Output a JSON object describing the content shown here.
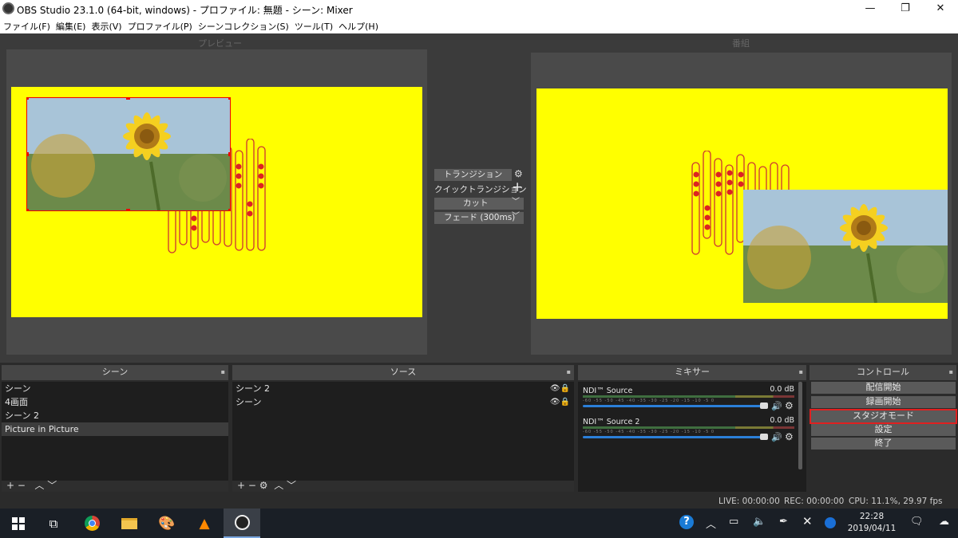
{
  "window": {
    "title": "OBS Studio 23.1.0 (64-bit, windows) - プロファイル: 無題 - シーン: Mixer",
    "minimize": "—",
    "maximize": "❐",
    "close": "✕"
  },
  "menu": [
    "ファイル(F)",
    "編集(E)",
    "表示(V)",
    "プロファイル(P)",
    "シーンコレクション(S)",
    "ツール(T)",
    "ヘルプ(H)"
  ],
  "preview": {
    "label": "プレビュー"
  },
  "program": {
    "label": "番組"
  },
  "transition": {
    "button": "トランジション",
    "quick": "クイックトランジション",
    "cut": "カット",
    "fade": "フェード (300ms)"
  },
  "scenes": {
    "title": "シーン",
    "items": [
      "シーン",
      "4画面",
      "シーン 2",
      "Picture in Picture"
    ],
    "selected": 3
  },
  "sources": {
    "title": "ソース",
    "items": [
      "シーン 2",
      "シーン"
    ]
  },
  "mixer": {
    "title": "ミキサー",
    "channels": [
      {
        "name": "NDI™ Source",
        "db": "0.0 dB"
      },
      {
        "name": "NDI™ Source 2",
        "db": "0.0 dB"
      }
    ],
    "scale": [
      "-60",
      "-55",
      "-50",
      "-45",
      "-40",
      "-35",
      "-30",
      "-25",
      "-20",
      "-15",
      "-10",
      "-5",
      "0"
    ]
  },
  "controls": {
    "title": "コントロール",
    "buttons": [
      "配信開始",
      "録画開始",
      "スタジオモード",
      "設定",
      "終了"
    ],
    "highlighted": 2
  },
  "status": {
    "live": "LIVE: 00:00:00",
    "rec": "REC: 00:00:00",
    "cpu": "CPU: 11.1%, 29.97 fps"
  },
  "taskbar": {
    "time": "22:28",
    "date": "2019/04/11"
  },
  "colors": {
    "stage": "#ffff00",
    "capsule": "#cc3333",
    "highlight": "#e02020",
    "fader": "#2b7fd8"
  }
}
